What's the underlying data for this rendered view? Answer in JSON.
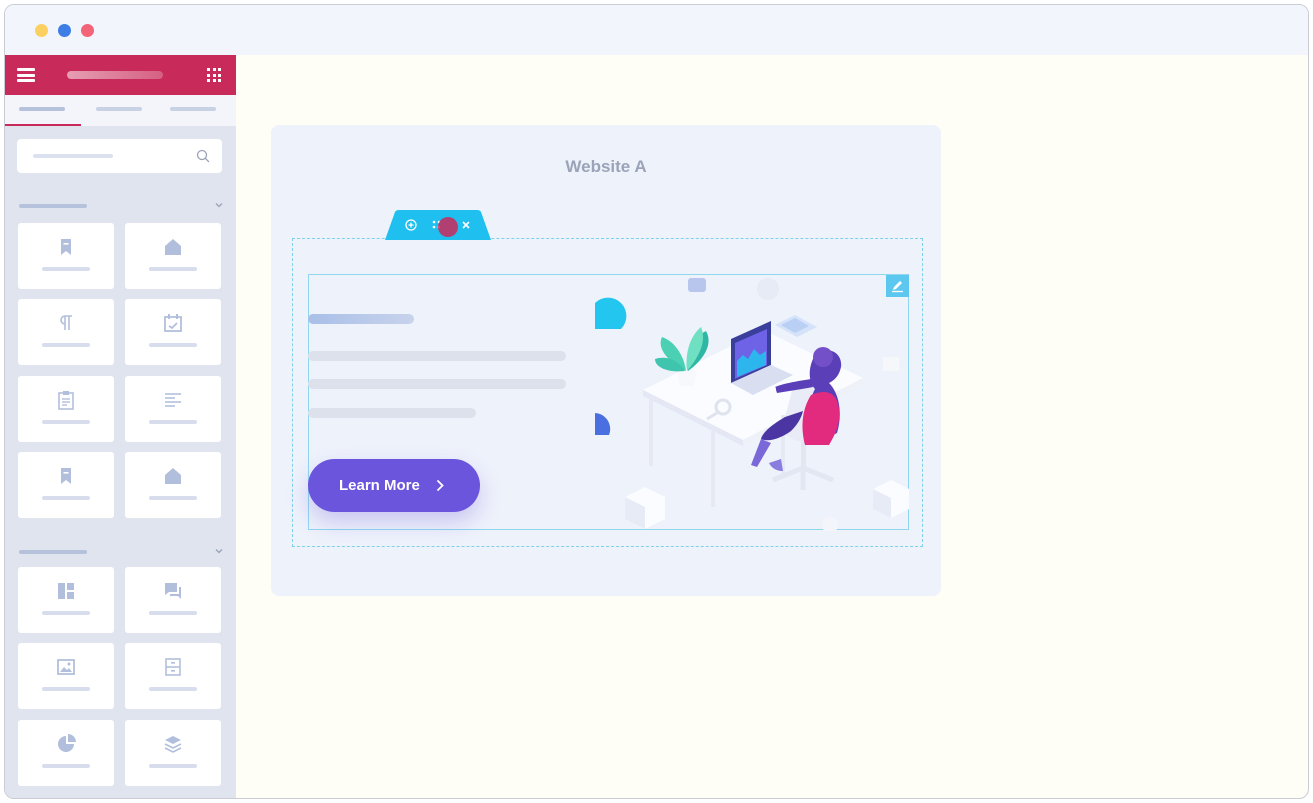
{
  "colors": {
    "brand": "#c82a5a",
    "accent_cyan": "#1fbfef",
    "button": "#6a55dc",
    "dot_yellow": "#fbd061",
    "dot_blue": "#3d7ee6",
    "dot_red": "#f36478"
  },
  "window": {
    "controls": [
      "minimize-dot",
      "zoom-dot",
      "close-dot"
    ]
  },
  "sidebar": {
    "header_icons": [
      "menu-icon",
      "apps-grid-icon"
    ],
    "search": {
      "placeholder": "",
      "icon": "search-icon"
    },
    "sections": [
      {
        "tiles": [
          {
            "icon": "bookmark-icon"
          },
          {
            "icon": "home-icon"
          },
          {
            "icon": "paragraph-icon"
          },
          {
            "icon": "calendar-icon"
          },
          {
            "icon": "clipboard-icon"
          },
          {
            "icon": "text-align-icon"
          },
          {
            "icon": "bookmark-icon"
          },
          {
            "icon": "home-icon"
          }
        ]
      },
      {
        "tiles": [
          {
            "icon": "layout-icon"
          },
          {
            "icon": "chat-icon"
          },
          {
            "icon": "image-icon"
          },
          {
            "icon": "archive-icon"
          },
          {
            "icon": "pie-chart-icon"
          },
          {
            "icon": "layers-icon"
          }
        ]
      }
    ]
  },
  "canvas": {
    "site_title": "Website A",
    "toolbar_icons": [
      "add-icon",
      "move-icon",
      "close-icon"
    ],
    "cta_label": "Learn More"
  }
}
